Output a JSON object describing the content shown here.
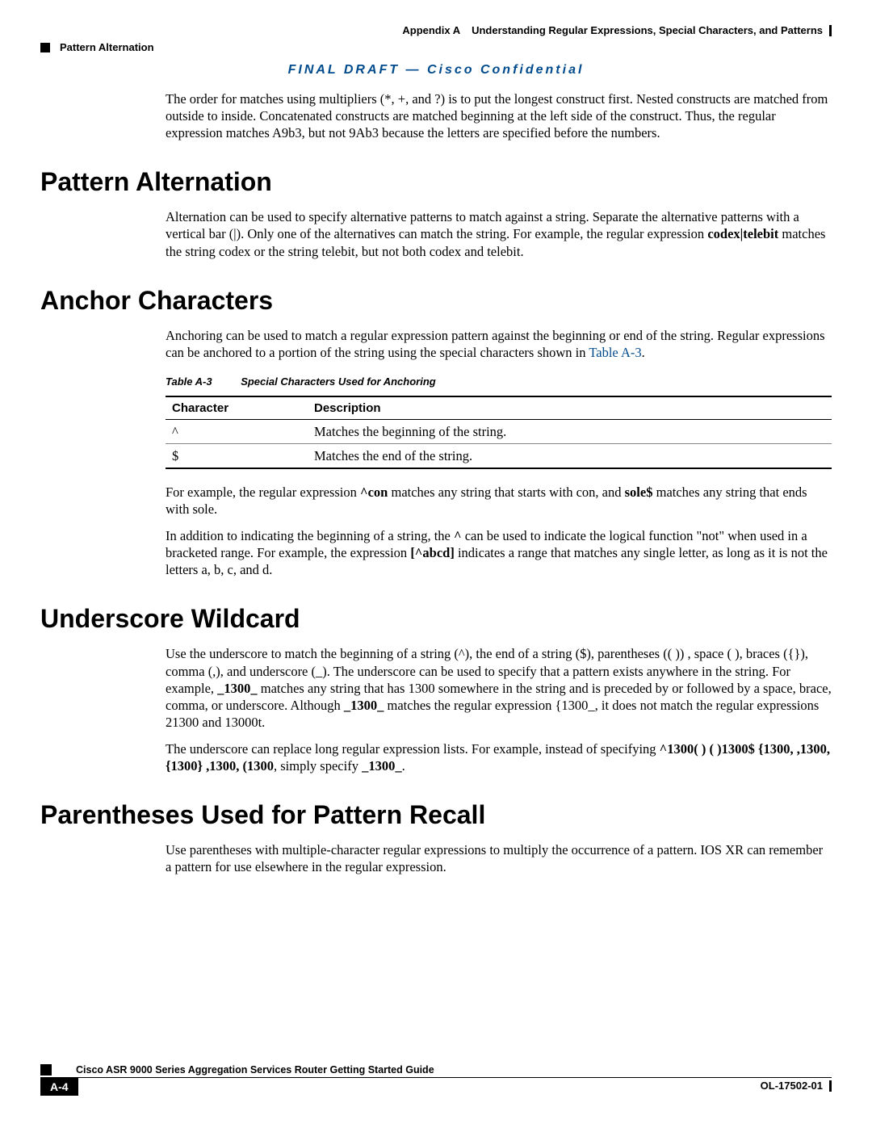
{
  "header": {
    "appendix_label": "Appendix A",
    "appendix_title": "Understanding Regular Expressions, Special Characters, and Patterns",
    "section_label": "Pattern Alternation"
  },
  "draft_line": "FINAL DRAFT — Cisco Confidential",
  "intro_paragraph": "The order for matches using multipliers (*, +, and ?) is to put the longest construct first. Nested constructs are matched from outside to inside. Concatenated constructs are matched beginning at the left side of the construct. Thus, the regular expression matches A9b3, but not 9Ab3 because the letters are specified before the numbers.",
  "sections": {
    "alternation": {
      "heading": "Pattern Alternation",
      "para_prefix": "Alternation can be used to specify alternative patterns to match against a string. Separate the alternative patterns with a vertical bar (|). Only one of the alternatives can match the string. For example, the regular expression ",
      "expr": "codex|telebit",
      "para_suffix": " matches the string codex or the string telebit, but not both codex and telebit."
    },
    "anchor": {
      "heading": "Anchor Characters",
      "para_prefix": "Anchoring can be used to match a regular expression pattern against the beginning or end of the string. Regular expressions can be anchored to a portion of the string using the special characters shown in ",
      "link_text": "Table A-3",
      "para_suffix": ".",
      "table_caption_label": "Table A-3",
      "table_caption_title": "Special Characters Used for Anchoring",
      "table": {
        "col1": "Character",
        "col2": "Description",
        "rows": [
          {
            "c": "^",
            "d": "Matches the beginning of the string."
          },
          {
            "c": "$",
            "d": "Matches the end of the string."
          }
        ]
      },
      "p2_prefix": "For example, the regular expression ",
      "p2_b1": "^con",
      "p2_mid": " matches any string that starts with con, and ",
      "p2_b2": "sole$",
      "p2_suffix": " matches any string that ends with sole.",
      "p3_prefix": "In addition to indicating the beginning of a string, the ",
      "p3_b1": "^",
      "p3_mid": " can be used to indicate the logical function \"not\" when used in a bracketed range. For example, the expression ",
      "p3_b2": "[^abcd]",
      "p3_suffix": " indicates a range that matches any single letter, as long as it is not the letters a, b, c, and d."
    },
    "underscore": {
      "heading": "Underscore Wildcard",
      "p1_prefix": "Use the underscore to match the beginning of a string (^), the end of a string ($), parentheses (( )) , space ( ), braces ({}), comma (,), and underscore (_). The underscore can be used to specify that a pattern exists anywhere in the string. For example, ",
      "p1_b1": "_1300_",
      "p1_mid": " matches any string that has 1300 somewhere in the string and is preceded by or followed by a space, brace, comma, or underscore. Although ",
      "p1_b2": "_1300_",
      "p1_suffix": " matches the regular expression {1300_, it does not match the regular expressions 21300 and 13000t.",
      "p2_prefix": "The underscore can replace long regular expression lists. For example, instead of specifying ",
      "p2_b1": "^1300( )  ( )1300$  {1300,  ,1300,  {1300}  ,1300,  (1300",
      "p2_mid": ", simply specify ",
      "p2_b2": "_1300_",
      "p2_suffix": "."
    },
    "parentheses": {
      "heading": "Parentheses Used for Pattern Recall",
      "para": "Use parentheses with multiple-character regular expressions to multiply the occurrence of a pattern. IOS XR can remember a pattern for use elsewhere in the regular expression."
    }
  },
  "footer": {
    "doc_title": "Cisco ASR 9000 Series Aggregation Services Router Getting Started Guide",
    "page_num": "A-4",
    "doc_id": "OL-17502-01"
  }
}
